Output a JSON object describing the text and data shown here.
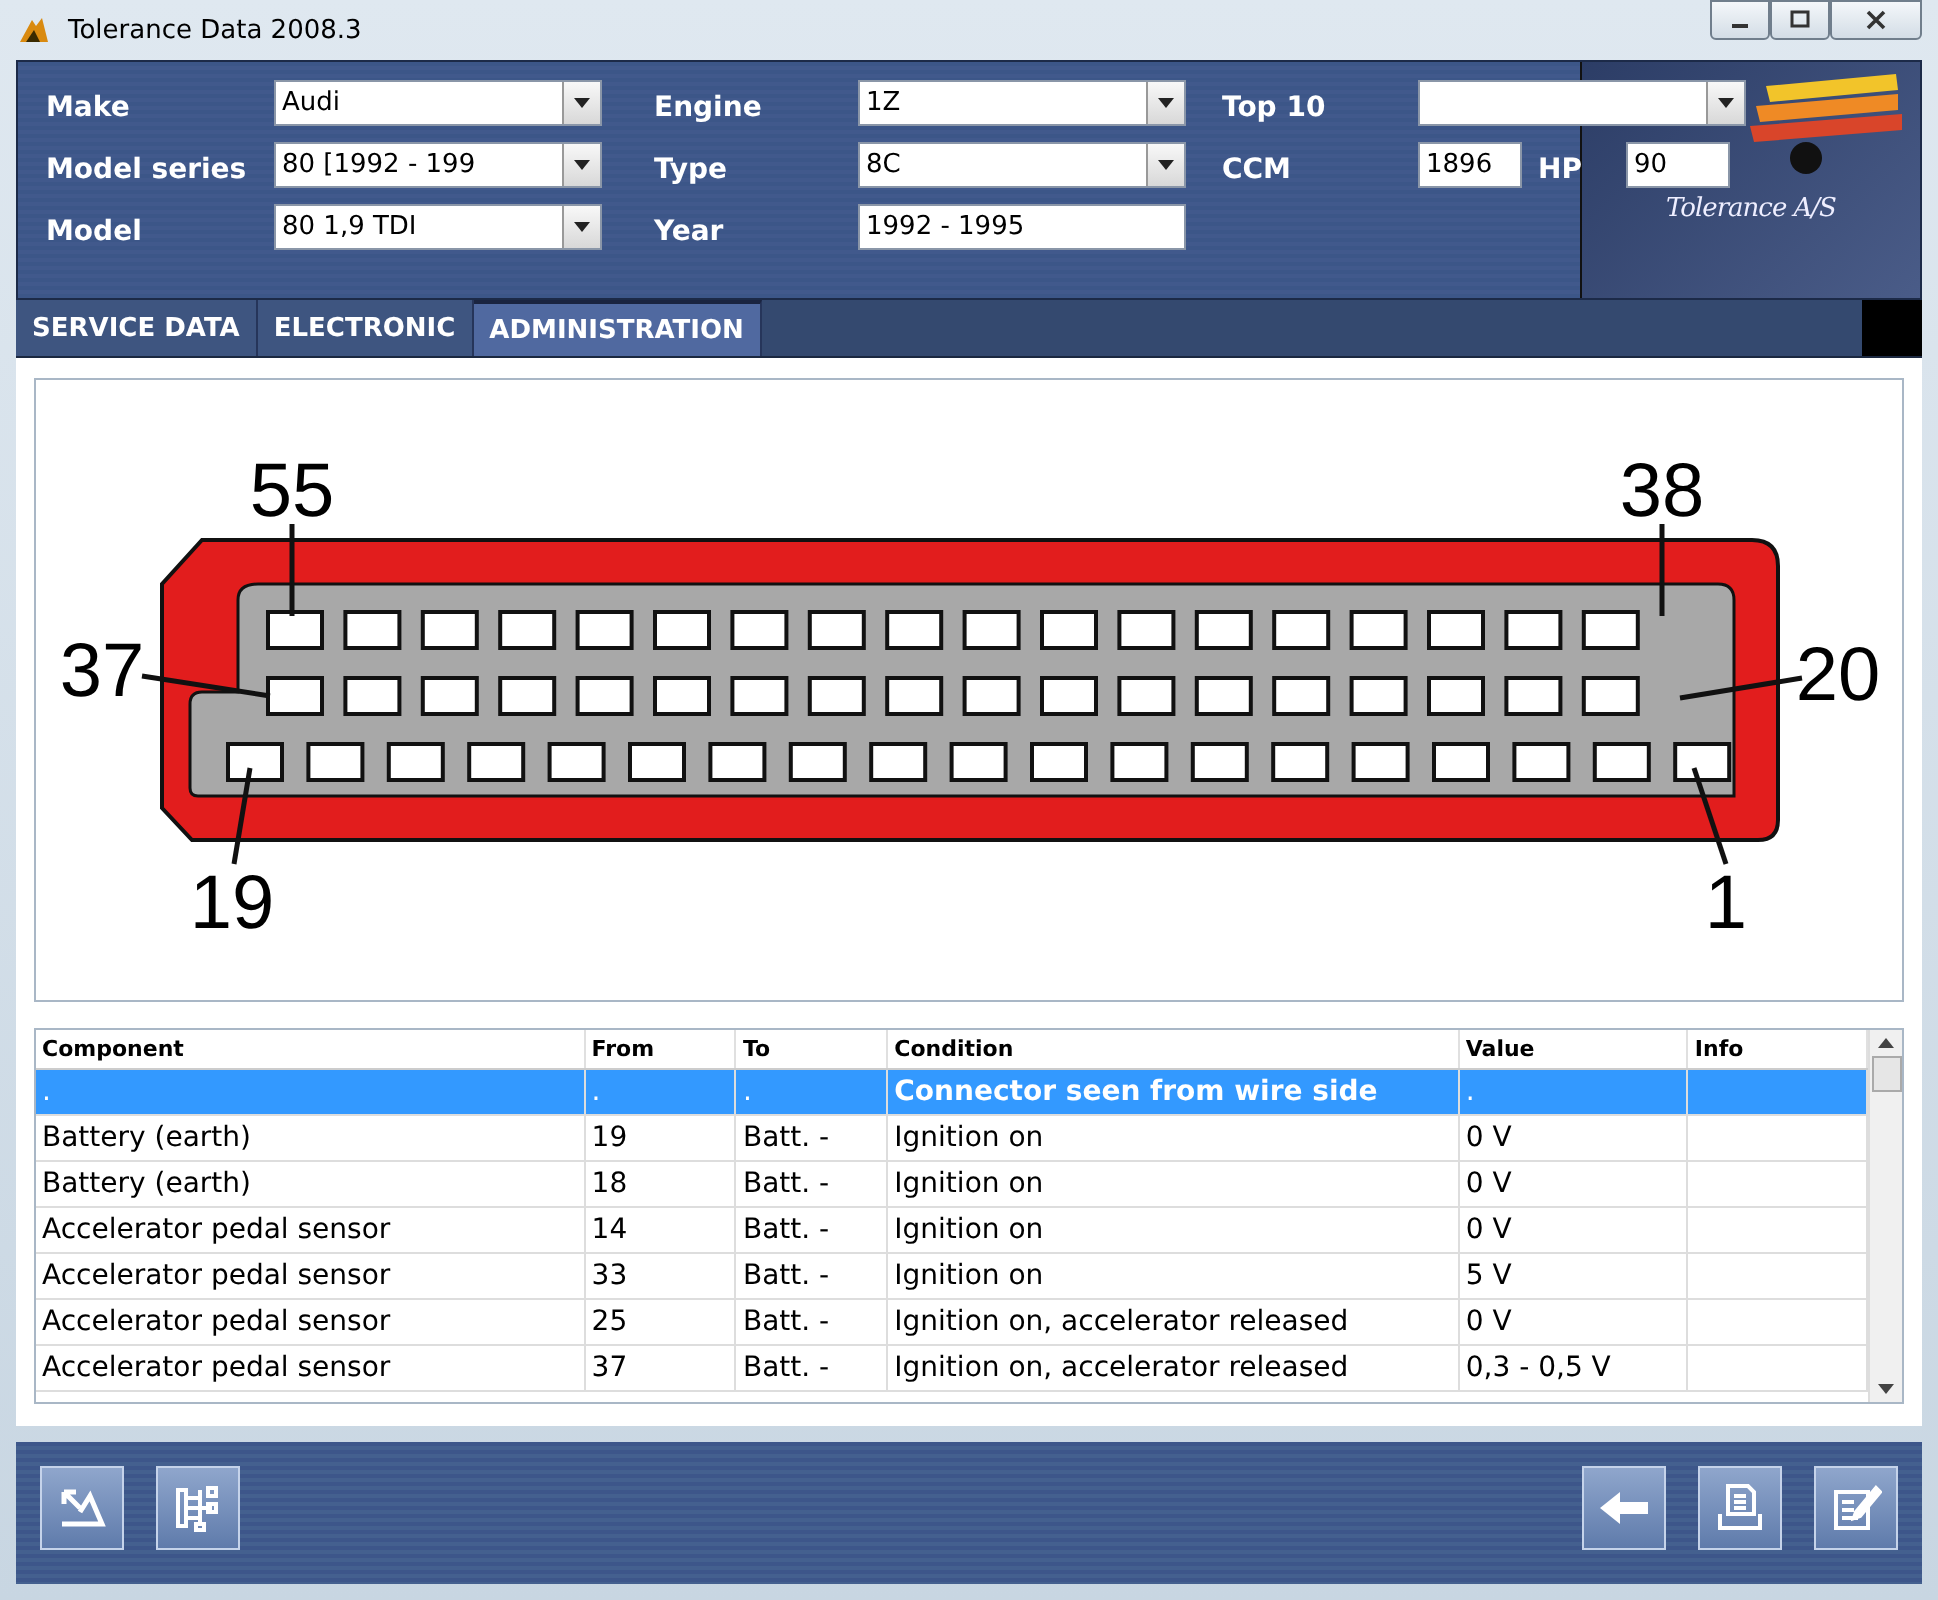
{
  "window": {
    "title": "Tolerance Data 2008.3"
  },
  "fields": [
    {
      "label": "Make",
      "value": "Audi",
      "kind": "dropdown"
    },
    {
      "label": "Model series",
      "value": "80 [1992 - 199",
      "kind": "dropdown"
    },
    {
      "label": "Model",
      "value": "80 1,9 TDI",
      "kind": "dropdown"
    },
    {
      "label": "Engine",
      "value": "1Z",
      "kind": "dropdown"
    },
    {
      "label": "Type",
      "value": "8C",
      "kind": "dropdown"
    },
    {
      "label": "Year",
      "value": "1992 - 1995",
      "kind": "text"
    },
    {
      "label": "Top 10",
      "kind": "dropdown"
    }
  ],
  "ccm": {
    "label": "CCM",
    "value": "1896"
  },
  "hp": {
    "label": "HP",
    "value": "90"
  },
  "logo": {
    "text": "Tolerance A/S"
  },
  "tabs": [
    {
      "label": "SERVICE DATA",
      "selected": false
    },
    {
      "label": "ELECTRONIC",
      "selected": false
    },
    {
      "label": "ADMINISTRATION",
      "selected": true
    }
  ],
  "connector": {
    "pin_labels": [
      "55",
      "38",
      "37",
      "20",
      "19",
      "1"
    ]
  },
  "table": {
    "columns": [
      "Component",
      "From",
      "To",
      "Condition",
      "Value",
      "Info"
    ],
    "rows": [
      {
        "cells": [
          ".",
          ".",
          ".",
          "Connector seen from wire side",
          "."
        ],
        "selected": true
      },
      {
        "cells": [
          "Battery (earth)",
          "19",
          "Batt. -",
          "Ignition on",
          "0 V"
        ],
        "selected": false
      },
      {
        "cells": [
          "Battery (earth)",
          "18",
          "Batt. -",
          "Ignition on",
          "0 V"
        ],
        "selected": false
      },
      {
        "cells": [
          "Accelerator pedal sensor",
          "14",
          "Batt. -",
          "Ignition on",
          "0 V"
        ],
        "selected": false
      },
      {
        "cells": [
          "Accelerator pedal sensor",
          "33",
          "Batt. -",
          "Ignition on",
          "5 V"
        ],
        "selected": false
      },
      {
        "cells": [
          "Accelerator pedal sensor",
          "25",
          "Batt. -",
          "Ignition on, accelerator released",
          "0 V"
        ],
        "selected": false
      },
      {
        "cells": [
          "Accelerator pedal sensor",
          "37",
          "Batt. -",
          "Ignition on, accelerator released",
          "0,3 - 0,5 V"
        ],
        "selected": false
      }
    ]
  }
}
